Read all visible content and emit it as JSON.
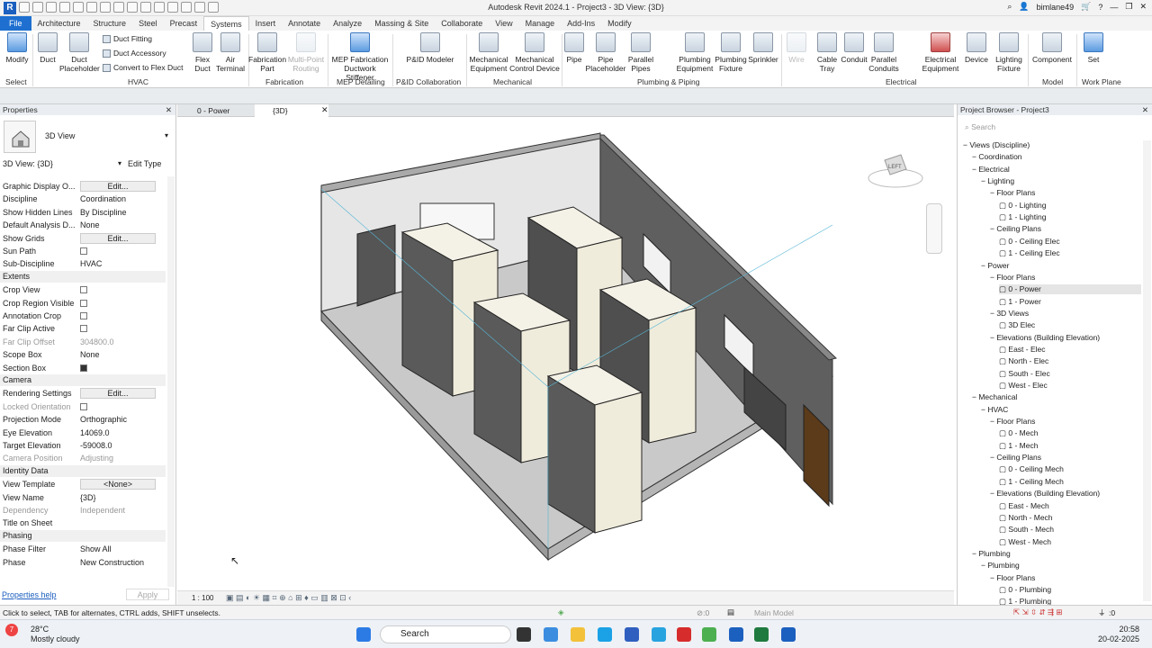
{
  "titlebar": {
    "title": "Autodesk Revit 2024.1 - Project3 - 3D View: {3D}",
    "user": "bimlane49"
  },
  "tabs": [
    "File",
    "Architecture",
    "Structure",
    "Steel",
    "Precast",
    "Systems",
    "Insert",
    "Annotate",
    "Analyze",
    "Massing & Site",
    "Collaborate",
    "View",
    "Manage",
    "Add-Ins",
    "Modify"
  ],
  "ribbon": {
    "modify": "Modify",
    "select": "Select",
    "duct": "Duct",
    "duct_placeholder": "Duct Placeholder",
    "duct_fitting": "Duct Fitting",
    "duct_accessory": "Duct Accessory",
    "convert": "Convert to Flex Duct",
    "flex_duct": "Flex Duct",
    "air_terminal": "Air Terminal",
    "hvac": "HVAC",
    "fab_part": "Fabrication Part",
    "multi_point": "Multi-Point Routing",
    "fabrication": "Fabrication",
    "mep_stiff": "MEP Fabrication Ductwork Stiffener",
    "mep_detailing": "MEP Detailing",
    "pid_modeler": "P&ID Modeler",
    "pid_collab": "P&ID Collaboration",
    "mech_equip": "Mechanical Equipment",
    "mech_ctrl": "Mechanical Control Device",
    "mechanical": "Mechanical",
    "pipe": "Pipe",
    "pipe_placeholder": "Pipe Placeholder",
    "parallel_pipes": "Parallel Pipes",
    "plumb_equip": "Plumbing Equipment",
    "plumb_fixture": "Plumbing Fixture",
    "sprinkler": "Sprinkler",
    "plumbing_piping": "Plumbing & Piping",
    "wire": "Wire",
    "cable_tray": "Cable Tray",
    "conduit": "Conduit",
    "parallel_conduits": "Parallel Conduits",
    "elec_equip": "Electrical Equipment",
    "device": "Device",
    "lighting_fixture": "Lighting Fixture",
    "electrical": "Electrical",
    "component": "Component",
    "model": "Model",
    "set": "Set",
    "work_plane": "Work Plane"
  },
  "properties": {
    "title": "Properties",
    "type": "3D View",
    "selector": "3D View: {3D}",
    "edit_type": "Edit Type",
    "rows1": [
      {
        "k": "Graphic Display O...",
        "v": "Edit..."
      },
      {
        "k": "Discipline",
        "v": "Coordination"
      },
      {
        "k": "Show Hidden Lines",
        "v": "By Discipline"
      },
      {
        "k": "Default Analysis D...",
        "v": "None"
      },
      {
        "k": "Show Grids",
        "v": "Edit..."
      },
      {
        "k": "Sun Path",
        "v": ""
      },
      {
        "k": "Sub-Discipline",
        "v": "HVAC"
      }
    ],
    "extents": "Extents",
    "rows2": [
      {
        "k": "Crop View",
        "v": ""
      },
      {
        "k": "Crop Region Visible",
        "v": ""
      },
      {
        "k": "Annotation Crop",
        "v": ""
      },
      {
        "k": "Far Clip Active",
        "v": ""
      },
      {
        "k": "Far Clip Offset",
        "v": "304800.0"
      },
      {
        "k": "Scope Box",
        "v": "None"
      },
      {
        "k": "Section Box",
        "v": ""
      }
    ],
    "camera": "Camera",
    "rows3": [
      {
        "k": "Rendering Settings",
        "v": "Edit..."
      },
      {
        "k": "Locked Orientation",
        "v": ""
      },
      {
        "k": "Projection Mode",
        "v": "Orthographic"
      },
      {
        "k": "Eye Elevation",
        "v": "14069.0"
      },
      {
        "k": "Target Elevation",
        "v": "-59008.0"
      },
      {
        "k": "Camera Position",
        "v": "Adjusting"
      }
    ],
    "identity": "Identity Data",
    "rows4": [
      {
        "k": "View Template",
        "v": "<None>"
      },
      {
        "k": "View Name",
        "v": "{3D}"
      },
      {
        "k": "Dependency",
        "v": "Independent"
      },
      {
        "k": "Title on Sheet",
        "v": ""
      }
    ],
    "phasing": "Phasing",
    "rows5": [
      {
        "k": "Phase Filter",
        "v": "Show All"
      },
      {
        "k": "Phase",
        "v": "New Construction"
      }
    ],
    "help": "Properties help",
    "apply": "Apply"
  },
  "viewtabs": [
    "0 - Power",
    "{3D}"
  ],
  "viewbar": {
    "scale": "1 : 100"
  },
  "viewcube": "LEFT",
  "browser": {
    "title": "Project Browser - Project3",
    "search": "Search",
    "items": [
      {
        "t": "Views (Discipline)",
        "l": 0
      },
      {
        "t": "Coordination",
        "l": 1
      },
      {
        "t": "Electrical",
        "l": 1
      },
      {
        "t": "Lighting",
        "l": 2
      },
      {
        "t": "Floor Plans",
        "l": 3
      },
      {
        "t": "0 - Lighting",
        "l": 4
      },
      {
        "t": "1 - Lighting",
        "l": 4
      },
      {
        "t": "Ceiling Plans",
        "l": 3
      },
      {
        "t": "0 - Ceiling Elec",
        "l": 4
      },
      {
        "t": "1 - Ceiling Elec",
        "l": 4
      },
      {
        "t": "Power",
        "l": 2
      },
      {
        "t": "Floor Plans",
        "l": 3
      },
      {
        "t": "0 - Power",
        "l": 4
      },
      {
        "t": "1 - Power",
        "l": 4
      },
      {
        "t": "3D Views",
        "l": 3
      },
      {
        "t": "3D Elec",
        "l": 4
      },
      {
        "t": "Elevations (Building Elevation)",
        "l": 3
      },
      {
        "t": "East - Elec",
        "l": 4
      },
      {
        "t": "North - Elec",
        "l": 4
      },
      {
        "t": "South - Elec",
        "l": 4
      },
      {
        "t": "West - Elec",
        "l": 4
      },
      {
        "t": "Mechanical",
        "l": 1
      },
      {
        "t": "HVAC",
        "l": 2
      },
      {
        "t": "Floor Plans",
        "l": 3
      },
      {
        "t": "0 - Mech",
        "l": 4
      },
      {
        "t": "1 - Mech",
        "l": 4
      },
      {
        "t": "Ceiling Plans",
        "l": 3
      },
      {
        "t": "0 - Ceiling Mech",
        "l": 4
      },
      {
        "t": "1 - Ceiling Mech",
        "l": 4
      },
      {
        "t": "Elevations (Building Elevation)",
        "l": 3
      },
      {
        "t": "East - Mech",
        "l": 4
      },
      {
        "t": "North - Mech",
        "l": 4
      },
      {
        "t": "South - Mech",
        "l": 4
      },
      {
        "t": "West - Mech",
        "l": 4
      },
      {
        "t": "Plumbing",
        "l": 1
      },
      {
        "t": "Plumbing",
        "l": 2
      },
      {
        "t": "Floor Plans",
        "l": 3
      },
      {
        "t": "0 - Plumbing",
        "l": 4
      },
      {
        "t": "1 - Plumbing",
        "l": 4
      }
    ]
  },
  "status": {
    "hint": "Click to select, TAB for alternates, CTRL adds, SHIFT unselects.",
    "model": "Main Model",
    "zero": ":0"
  },
  "taskbar": {
    "temp": "28°C",
    "weather": "Mostly cloudy",
    "search": "Search",
    "time": "20:58",
    "date": "20-02-2025",
    "badge": "7"
  }
}
